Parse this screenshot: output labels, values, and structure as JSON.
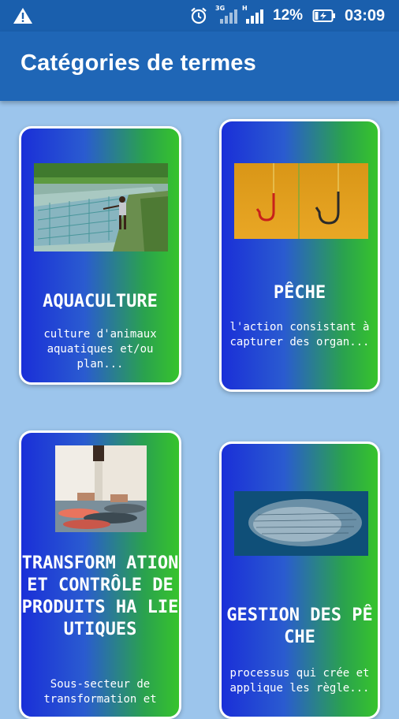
{
  "status_bar": {
    "time": "03:09",
    "battery": "12%",
    "network_3g": "3G",
    "network_h": "H",
    "icons": [
      "warning-icon",
      "alarm-icon",
      "signal-3g-icon",
      "signal-h-icon",
      "battery-charging-icon"
    ]
  },
  "app_bar": {
    "title": "Catégories de termes"
  },
  "categories": [
    {
      "title": "AQUACULTURE",
      "description": "culture  d'animaux aquatiques et/ou plan...",
      "image": "fish-farm-photo"
    },
    {
      "title": "PÊCHE",
      "description": "l'action consistant à capturer des organ...",
      "image": "fishing-hooks-photo"
    },
    {
      "title": "TRANSFORM ATION ET CONTRÔLE DE PRODUITS HA LIEUTIQUES",
      "description": "Sous-secteur de transformation et",
      "image": "fish-processing-photo"
    },
    {
      "title": "GESTION DES PÊCHE",
      "description": "processus qui crée et applique les règle...",
      "image": "fish-school-photo"
    }
  ],
  "colors": {
    "background": "#9cc5ec",
    "app_bar": "#1f66b6",
    "status_bar": "#1a5fad",
    "card_gradient_start": "#1a2fd8",
    "card_gradient_end": "#37c42c"
  }
}
